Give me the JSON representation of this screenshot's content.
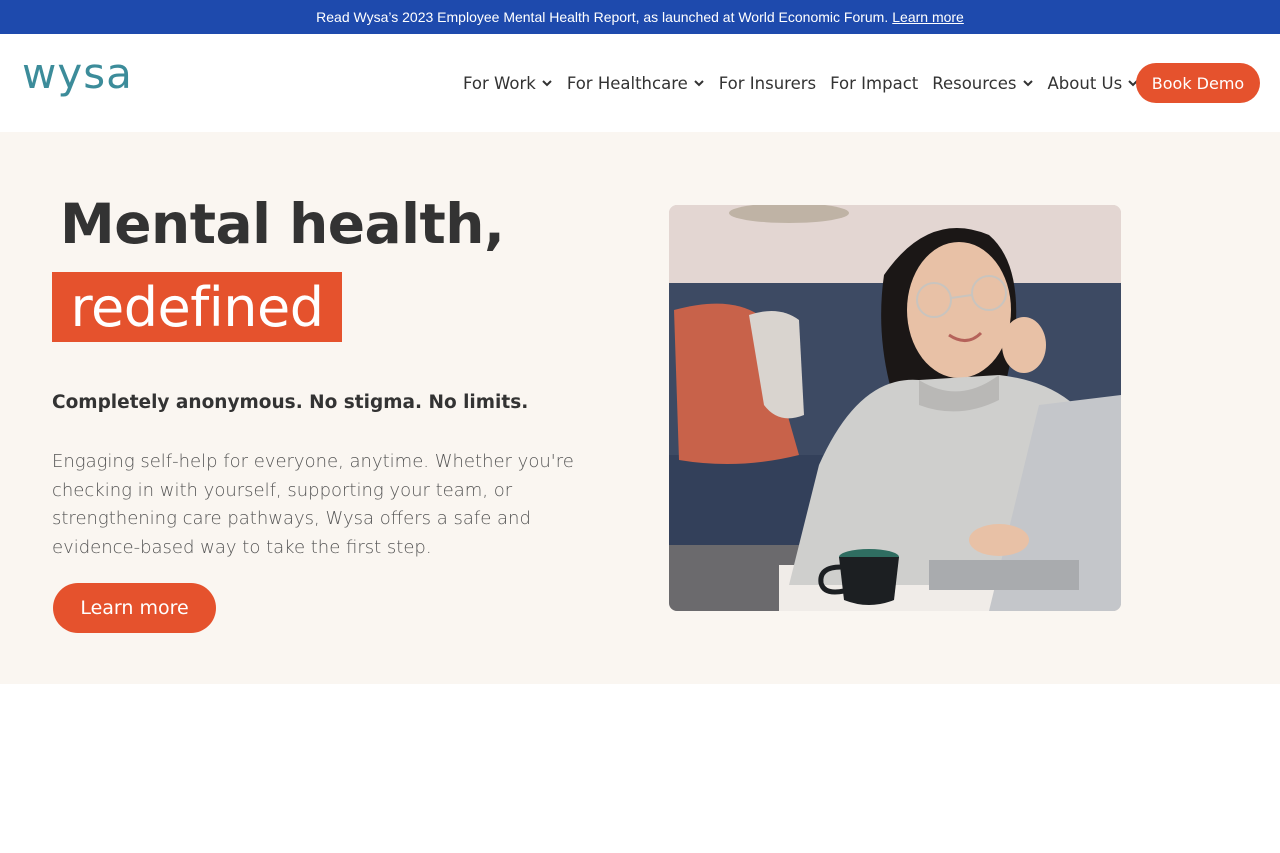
{
  "banner": {
    "text": "Read Wysa’s 2023 Employee Mental Health Report, as launched at World Economic Forum.",
    "link": "Learn more"
  },
  "header": {
    "logo_text": "wysa",
    "nav": [
      {
        "label": "For Work",
        "has_dropdown": true
      },
      {
        "label": "For Healthcare",
        "has_dropdown": true
      },
      {
        "label": "For Insurers",
        "has_dropdown": false
      },
      {
        "label": "For Impact",
        "has_dropdown": false
      },
      {
        "label": "Resources",
        "has_dropdown": true
      },
      {
        "label": "About Us",
        "has_dropdown": true
      }
    ],
    "cta": "Book Demo"
  },
  "hero": {
    "headline_line1": "Mental health,",
    "headline_line2": "redefined",
    "tagline": "Completely anonymous. No stigma. No limits.",
    "description": "Engaging self-help for everyone, anytime. Whether you're checking in with yourself, supporting your team, or strengthening care pathways, Wysa offers a safe and evidence-based way to take the first step.",
    "button": "Learn more",
    "photo": "woman-with-glasses-at-laptop"
  },
  "colors": {
    "banner_bg": "#1e4aad",
    "accent": "#e5522d",
    "logo": "#3c8c9a",
    "hero_bg": "#faf6f1"
  }
}
